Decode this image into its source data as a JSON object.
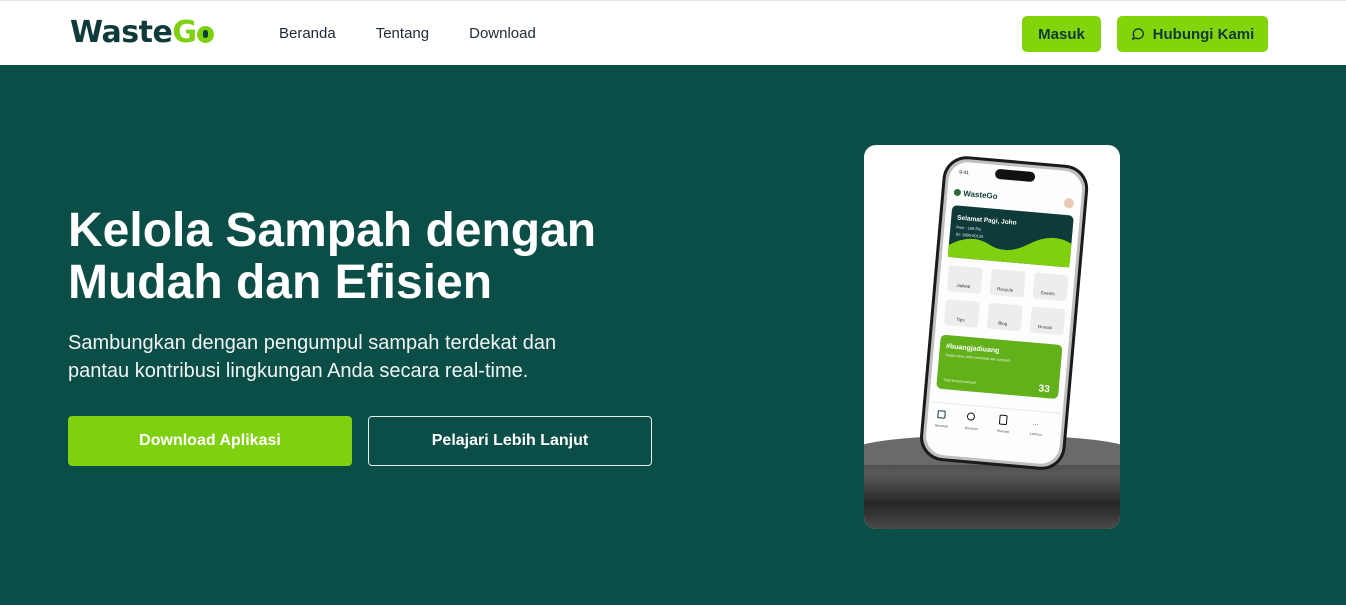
{
  "brand": {
    "prefix": "Waste",
    "suffix": "G",
    "suffix2": "o"
  },
  "nav": {
    "items": [
      "Beranda",
      "Tentang",
      "Download"
    ]
  },
  "header": {
    "login_label": "Masuk",
    "contact_label": "Hubungi Kami"
  },
  "hero": {
    "title_line1": "Kelola Sampah dengan",
    "title_line2": "Mudah dan Efisien",
    "subtitle_line1": "Sambungkan dengan pengumpul sampah terdekat dan",
    "subtitle_line2": "pantau kontribusi lingkungan Anda secara real-time.",
    "primary_cta": "Download Aplikasi",
    "secondary_cta": "Pelajari Lebih Lanjut"
  },
  "phone": {
    "status_time": "9:41",
    "app_name": "WasteGo",
    "greeting": "Selamat Pagi, John",
    "points": "Poin : 109 Pts",
    "id": "ID: 1890-00124",
    "menu": [
      "Jadwal",
      "Recycle",
      "Events",
      "Tips",
      "Blog",
      "Donasi"
    ],
    "promo_title": "#buangjadiuang",
    "promo_text": "Setiap kamu lolos membuat dan sampah",
    "promo_note": "Total tempat sampah",
    "promo_count": "33",
    "tabs": [
      "Beranda",
      "Bantuan",
      "Riwayat",
      "Lainnya"
    ]
  },
  "colors": {
    "bg": "#0b4d47",
    "accent": "#84d40b",
    "dark": "#0e3b39"
  }
}
